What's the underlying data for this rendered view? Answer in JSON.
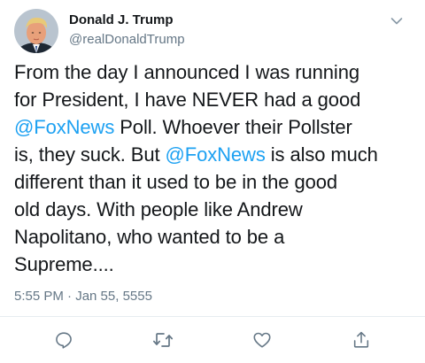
{
  "author": {
    "display_name": "Donald J. Trump",
    "handle": "@realDonaldTrump"
  },
  "tweet": {
    "lines": [
      [
        {
          "t": "From the day I announced I was running",
          "m": false
        }
      ],
      [
        {
          "t": "for President, I have NEVER had a good",
          "m": false
        }
      ],
      [
        {
          "t": "@FoxNews",
          "m": true
        },
        {
          "t": " Poll. Whoever their Pollster",
          "m": false
        }
      ],
      [
        {
          "t": "is, they suck. But ",
          "m": false
        },
        {
          "t": "@FoxNews",
          "m": true
        },
        {
          "t": " is also much",
          "m": false
        }
      ],
      [
        {
          "t": "different than it used to be in the good",
          "m": false
        }
      ],
      [
        {
          "t": "old days. With people like Andrew",
          "m": false
        }
      ],
      [
        {
          "t": "Napolitano, who wanted to be a",
          "m": false
        }
      ],
      [
        {
          "t": "Supreme....",
          "m": false
        }
      ]
    ],
    "timestamp": "5:55 PM · Jan 55, 5555"
  },
  "actions": {
    "reply_icon": "reply-icon",
    "retweet_icon": "retweet-icon",
    "like_icon": "like-icon",
    "share_icon": "share-icon"
  },
  "colors": {
    "mention": "#1da1f2",
    "secondary_text": "#657786",
    "primary_text": "#14171a",
    "divider": "#e6ecf0"
  }
}
